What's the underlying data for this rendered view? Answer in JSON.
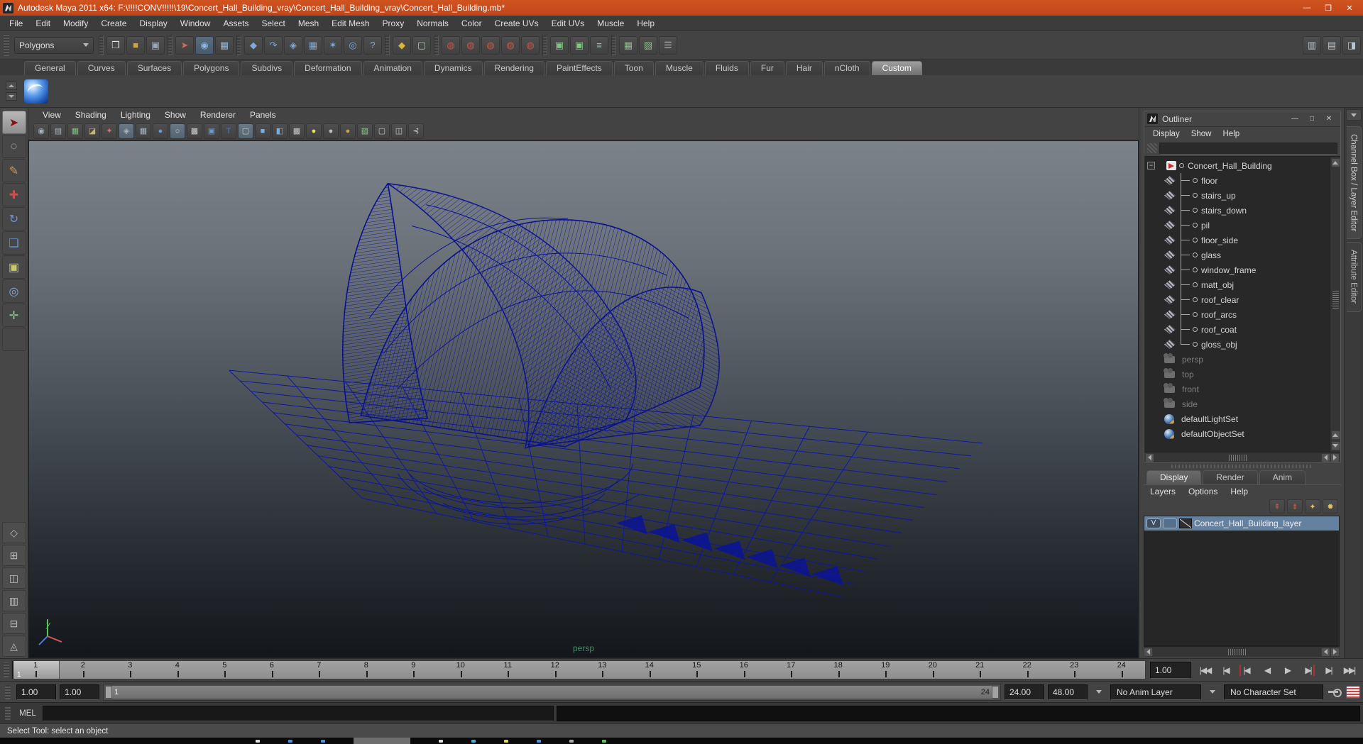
{
  "titlebar": {
    "title": "Autodesk Maya 2011 x64: F:\\!!!!CONV!!!!!\\19\\Concert_Hall_Building_vray\\Concert_Hall_Building_vray\\Concert_Hall_Building.mb*",
    "minimize": "—",
    "maximize": "❒",
    "close": "✕"
  },
  "menubar": {
    "items": [
      "File",
      "Edit",
      "Modify",
      "Create",
      "Display",
      "Window",
      "Assets",
      "Select",
      "Mesh",
      "Edit Mesh",
      "Proxy",
      "Normals",
      "Color",
      "Create UVs",
      "Edit UVs",
      "Muscle",
      "Help"
    ]
  },
  "statusline": {
    "menuset": "Polygons",
    "scene_icons": [
      {
        "name": "new-scene-button",
        "glyph": "❒",
        "color": "#e6e6e6"
      },
      {
        "name": "open-scene-button",
        "glyph": "■",
        "color": "#d2a43c"
      },
      {
        "name": "save-scene-button",
        "glyph": "▣",
        "color": "#9aa7b5"
      }
    ],
    "selection_icons": [
      {
        "name": "select-by-hierarchy-button",
        "glyph": "➤",
        "color": "#cf6a5a"
      },
      {
        "name": "select-by-object-button",
        "glyph": "◉",
        "color": "#8cb4e2",
        "active": true
      },
      {
        "name": "select-by-component-button",
        "glyph": "▦",
        "color": "#8cb4e2"
      }
    ],
    "mask_icons": [
      {
        "name": "select-points-mask-button",
        "glyph": "◆",
        "color": "#7fa8d9"
      },
      {
        "name": "select-curves-mask-button",
        "glyph": "↷",
        "color": "#7fa8d9"
      },
      {
        "name": "select-surfaces-mask-button",
        "glyph": "◈",
        "color": "#7fa8d9"
      },
      {
        "name": "select-deformations-mask-button",
        "glyph": "▦",
        "color": "#7fa8d9"
      },
      {
        "name": "select-dynamics-mask-button",
        "glyph": "✶",
        "color": "#7fa8d9"
      },
      {
        "name": "select-rendering-mask-button",
        "glyph": "◎",
        "color": "#7fa8d9"
      },
      {
        "name": "select-misc-mask-button",
        "glyph": "?",
        "color": "#7fa8d9"
      }
    ],
    "lock_icons": [
      {
        "name": "lock-selection-button",
        "glyph": "◆",
        "color": "#d8b83c"
      },
      {
        "name": "highlight-selection-button",
        "glyph": "▢",
        "color": "#a8c8a8"
      }
    ],
    "snap_icons": [
      {
        "name": "snap-to-grids-button",
        "glyph": "◍",
        "color": "#c05848"
      },
      {
        "name": "snap-to-curves-button",
        "glyph": "◍",
        "color": "#c05848"
      },
      {
        "name": "snap-to-points-button",
        "glyph": "◍",
        "color": "#c05848"
      },
      {
        "name": "snap-to-view-planes-button",
        "glyph": "◍",
        "color": "#c05848"
      },
      {
        "name": "make-live-button",
        "glyph": "◍",
        "color": "#c05848"
      }
    ],
    "history_icons": [
      {
        "name": "input-connections-button",
        "glyph": "▣",
        "color": "#7ec87e"
      },
      {
        "name": "output-connections-button",
        "glyph": "▣",
        "color": "#7ec87e"
      },
      {
        "name": "construction-history-button",
        "glyph": "≡",
        "color": "#9cc4cc"
      }
    ],
    "render_icons": [
      {
        "name": "render-current-frame-button",
        "glyph": "▦",
        "color": "#8fb98f"
      },
      {
        "name": "ipr-render-button",
        "glyph": "▨",
        "color": "#8fb98f"
      },
      {
        "name": "render-settings-button",
        "glyph": "☰",
        "color": "#b0b0b0"
      }
    ],
    "right_toggles": [
      {
        "name": "show-channel-box-toggle",
        "glyph": "▥",
        "color": "#b8c4d0"
      },
      {
        "name": "show-tool-settings-toggle",
        "glyph": "▤",
        "color": "#b8c4d0"
      },
      {
        "name": "show-attribute-editor-toggle",
        "glyph": "◨",
        "color": "#b8c4d0"
      }
    ]
  },
  "shelf": {
    "tabs": [
      "General",
      "Curves",
      "Surfaces",
      "Polygons",
      "Subdivs",
      "Deformation",
      "Animation",
      "Dynamics",
      "Rendering",
      "PaintEffects",
      "Toon",
      "Muscle",
      "Fluids",
      "Fur",
      "Hair",
      "nCloth",
      "Custom"
    ],
    "active_tab": "Custom"
  },
  "toolbox": {
    "tools": [
      {
        "name": "select-tool",
        "glyph": "➤",
        "color": "#8a1010",
        "active": true
      },
      {
        "name": "lasso-select-tool",
        "glyph": "◌",
        "color": "#d8d8d8"
      },
      {
        "name": "paint-select-tool",
        "glyph": "✎",
        "color": "#c89858"
      },
      {
        "name": "move-tool",
        "glyph": "✚",
        "color": "#c85050"
      },
      {
        "name": "rotate-tool",
        "glyph": "↻",
        "color": "#6898d8"
      },
      {
        "name": "scale-tool",
        "glyph": "❑",
        "color": "#6898d8"
      },
      {
        "name": "universal-manipulator-tool",
        "glyph": "▣",
        "color": "#c8c870"
      },
      {
        "name": "soft-modification-tool",
        "glyph": "◎",
        "color": "#88a8d8"
      },
      {
        "name": "show-manipulator-tool",
        "glyph": "✛",
        "color": "#88c888"
      },
      {
        "name": "last-tool-slot",
        "glyph": "",
        "color": "#777777"
      }
    ],
    "layouts": [
      {
        "name": "layout-single-pane-button",
        "glyph": "◇",
        "color": "#b8b8b8"
      },
      {
        "name": "layout-four-pane-button",
        "glyph": "⊞",
        "color": "#b8b8b8"
      },
      {
        "name": "layout-outliner-persp-button",
        "glyph": "◫",
        "color": "#b8b8b8"
      },
      {
        "name": "layout-split-list-button",
        "glyph": "▥",
        "color": "#b8b8b8"
      },
      {
        "name": "layout-persp-graph-button",
        "glyph": "⊟",
        "color": "#b8b8b8"
      },
      {
        "name": "layout-custom-button",
        "glyph": "◬",
        "color": "#b8b8b8"
      }
    ]
  },
  "panel": {
    "menus": [
      "View",
      "Shading",
      "Lighting",
      "Show",
      "Renderer",
      "Panels"
    ],
    "toolbar": [
      {
        "name": "camera-attributes-button",
        "glyph": "◉",
        "color": "#a8b4c0"
      },
      {
        "name": "camera-bookmarks-button",
        "glyph": "▤",
        "color": "#a8b4c0"
      },
      {
        "name": "image-plane-button",
        "glyph": "▦",
        "color": "#7fbf7f"
      },
      {
        "name": "view-compass-button",
        "glyph": "◪",
        "color": "#c8b070"
      },
      {
        "name": "2d-pan-zoom-button",
        "glyph": "✦",
        "color": "#c87878"
      },
      {
        "name": "grid-toggle-button",
        "glyph": "◈",
        "color": "#a8b4c0",
        "active": true
      },
      {
        "name": "film-gate-button",
        "glyph": "▦",
        "color": "#a8b4c0"
      },
      {
        "name": "resolution-gate-button",
        "glyph": "●",
        "color": "#6898d0"
      },
      {
        "name": "gate-mask-button",
        "glyph": "○",
        "color": "#d0d0d0",
        "active": true
      },
      {
        "name": "field-chart-button",
        "glyph": "▩",
        "color": "#d0d0d0"
      },
      {
        "name": "safe-action-button",
        "glyph": "▣",
        "color": "#6898d0"
      },
      {
        "name": "safe-title-button",
        "glyph": "T",
        "color": "#4a78c8"
      },
      {
        "name": "wireframe-display-button",
        "glyph": "▢",
        "color": "#c8c8c8",
        "active": true
      },
      {
        "name": "smooth-shade-button",
        "glyph": "■",
        "color": "#78aee0"
      },
      {
        "name": "textured-display-button",
        "glyph": "◧",
        "color": "#78aee0"
      },
      {
        "name": "use-default-material-button",
        "glyph": "▩",
        "color": "#c8c8c8"
      },
      {
        "name": "use-all-lights-button",
        "glyph": "●",
        "color": "#e8e455"
      },
      {
        "name": "use-default-light-button",
        "glyph": "●",
        "color": "#c0c0c0"
      },
      {
        "name": "use-selected-light-button",
        "glyph": "●",
        "color": "#c8a04a"
      },
      {
        "name": "isolate-select-button",
        "glyph": "▧",
        "color": "#88c888"
      },
      {
        "name": "xray-display-button",
        "glyph": "▢",
        "color": "#c8c8c8"
      },
      {
        "name": "xray-joints-button",
        "glyph": "◫",
        "color": "#c8c8c8"
      },
      {
        "name": "plugin-display-button",
        "glyph": "⊰",
        "color": "#c8c8c8"
      }
    ],
    "camera_label": "persp",
    "axis_y_label": "y"
  },
  "outliner": {
    "title": "Outliner",
    "window_buttons": {
      "minimize": "—",
      "maximize": "□",
      "close": "✕"
    },
    "menus": [
      "Display",
      "Show",
      "Help"
    ],
    "expand_glyph": "−",
    "items": [
      {
        "label": "Concert_Hall_Building",
        "cls": "root transform"
      },
      {
        "label": "floor",
        "cls": "mesh"
      },
      {
        "label": "stairs_up",
        "cls": "mesh"
      },
      {
        "label": "stairs_down",
        "cls": "mesh"
      },
      {
        "label": "pil",
        "cls": "mesh"
      },
      {
        "label": "floor_side",
        "cls": "mesh"
      },
      {
        "label": "glass",
        "cls": "mesh"
      },
      {
        "label": "window_frame",
        "cls": "mesh"
      },
      {
        "label": "matt_obj",
        "cls": "mesh"
      },
      {
        "label": "roof_clear",
        "cls": "mesh"
      },
      {
        "label": "roof_arcs",
        "cls": "mesh"
      },
      {
        "label": "roof_coat",
        "cls": "mesh"
      },
      {
        "label": "gloss_obj",
        "cls": "mesh last"
      },
      {
        "label": "persp",
        "cls": "camera grayed"
      },
      {
        "label": "top",
        "cls": "camera grayed"
      },
      {
        "label": "front",
        "cls": "camera grayed"
      },
      {
        "label": "side",
        "cls": "camera grayed"
      },
      {
        "label": "defaultLightSet",
        "cls": "set"
      },
      {
        "label": "defaultObjectSet",
        "cls": "set"
      }
    ]
  },
  "layer_editor": {
    "tabs": [
      {
        "label": "Display",
        "active": true,
        "name": "tab-display"
      },
      {
        "label": "Render",
        "name": "tab-render"
      },
      {
        "label": "Anim",
        "name": "tab-anim"
      }
    ],
    "menus": [
      "Layers",
      "Options",
      "Help"
    ],
    "icon_buttons": [
      {
        "name": "move-layer-up-button",
        "glyph": "⇞",
        "color": "#c05848"
      },
      {
        "name": "move-layer-down-button",
        "glyph": "⇟",
        "color": "#c05848"
      },
      {
        "name": "create-empty-layer-button",
        "glyph": "✦",
        "color": "#e0c060"
      },
      {
        "name": "create-layer-from-selected-button",
        "glyph": "✹",
        "color": "#e0c060"
      }
    ],
    "layer": {
      "visibility_label": "V",
      "name": "Concert_Hall_Building_layer"
    }
  },
  "right_tabs": {
    "items": [
      "Channel Box / Layer Editor",
      "Attribute Editor"
    ]
  },
  "timeline": {
    "frames": [
      "1",
      "2",
      "3",
      "4",
      "5",
      "6",
      "7",
      "8",
      "9",
      "10",
      "11",
      "12",
      "13",
      "14",
      "15",
      "16",
      "17",
      "18",
      "19",
      "20",
      "21",
      "22",
      "23",
      "24"
    ],
    "current_frame": "1",
    "current_time": "1.00"
  },
  "playback": {
    "buttons": [
      {
        "name": "go-to-start-button",
        "glyph": "|◀◀"
      },
      {
        "name": "step-back-frame-button",
        "glyph": "|◀"
      },
      {
        "name": "step-back-key-button",
        "glyph": "|◀",
        "accent": "red-left"
      },
      {
        "name": "play-backwards-button",
        "glyph": "◀"
      },
      {
        "name": "play-forwards-button",
        "glyph": "▶"
      },
      {
        "name": "step-forward-key-button",
        "glyph": "▶|",
        "accent": "red-right"
      },
      {
        "name": "step-forward-frame-button",
        "glyph": "▶|"
      },
      {
        "name": "go-to-end-button",
        "glyph": "▶▶|"
      }
    ]
  },
  "range_slider": {
    "anim_start": "1.00",
    "playback_start": "1.00",
    "bar_start_label": "1",
    "bar_end_label": "24",
    "playback_end": "24.00",
    "anim_end": "48.00",
    "anim_layer": "No Anim Layer",
    "character_set": "No Character Set"
  },
  "command_line": {
    "label": "MEL"
  },
  "help_line": {
    "text": "Select Tool: select an object"
  }
}
